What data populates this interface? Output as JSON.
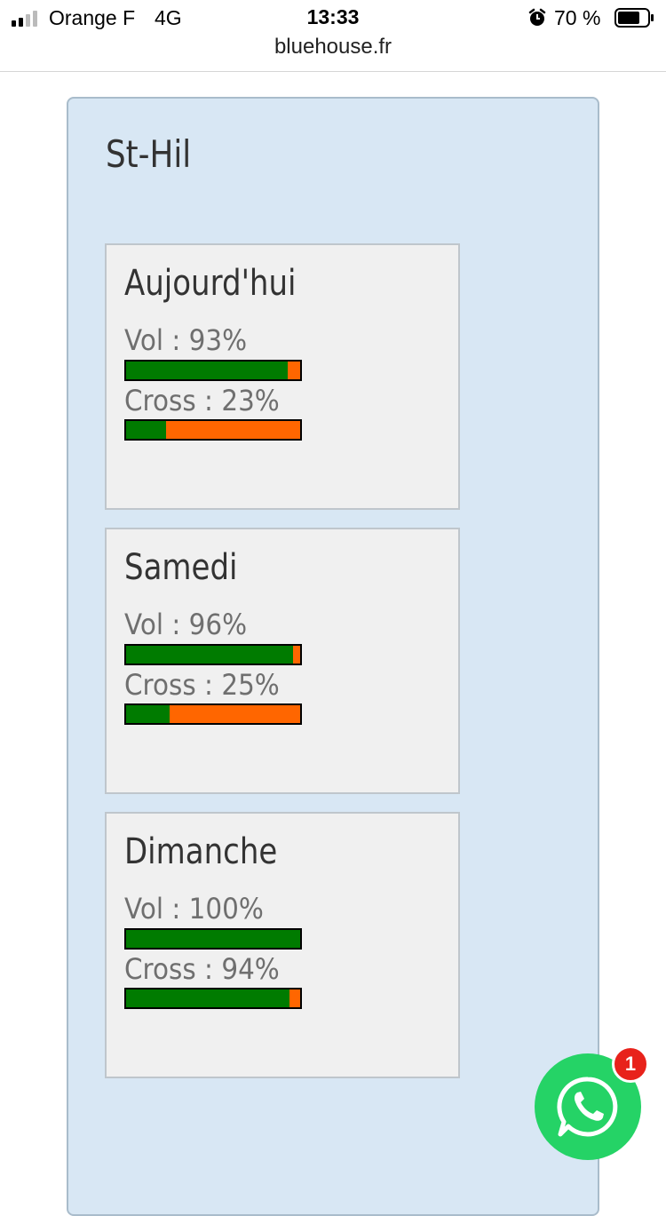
{
  "status_bar": {
    "carrier": "Orange F",
    "network": "4G",
    "time": "13:33",
    "battery_percent": "70 %"
  },
  "browser": {
    "url": "bluehouse.fr"
  },
  "location": {
    "title": "St-Hil"
  },
  "forecast": [
    {
      "day": "Aujourd'hui",
      "metrics": [
        {
          "label": "Vol : 93%",
          "value": 93
        },
        {
          "label": "Cross : 23%",
          "value": 23
        }
      ]
    },
    {
      "day": "Samedi",
      "metrics": [
        {
          "label": "Vol : 96%",
          "value": 96
        },
        {
          "label": "Cross : 25%",
          "value": 25
        }
      ]
    },
    {
      "day": "Dimanche",
      "metrics": [
        {
          "label": "Vol : 100%",
          "value": 100
        },
        {
          "label": "Cross : 94%",
          "value": 94
        }
      ]
    }
  ],
  "chat_widget": {
    "icon": "whatsapp-icon",
    "badge_count": "1"
  },
  "colors": {
    "bar_good": "#007b00",
    "bar_bad": "#ff6600",
    "panel_bg": "#d8e7f4",
    "whatsapp": "#25d366",
    "badge": "#e8221b"
  }
}
